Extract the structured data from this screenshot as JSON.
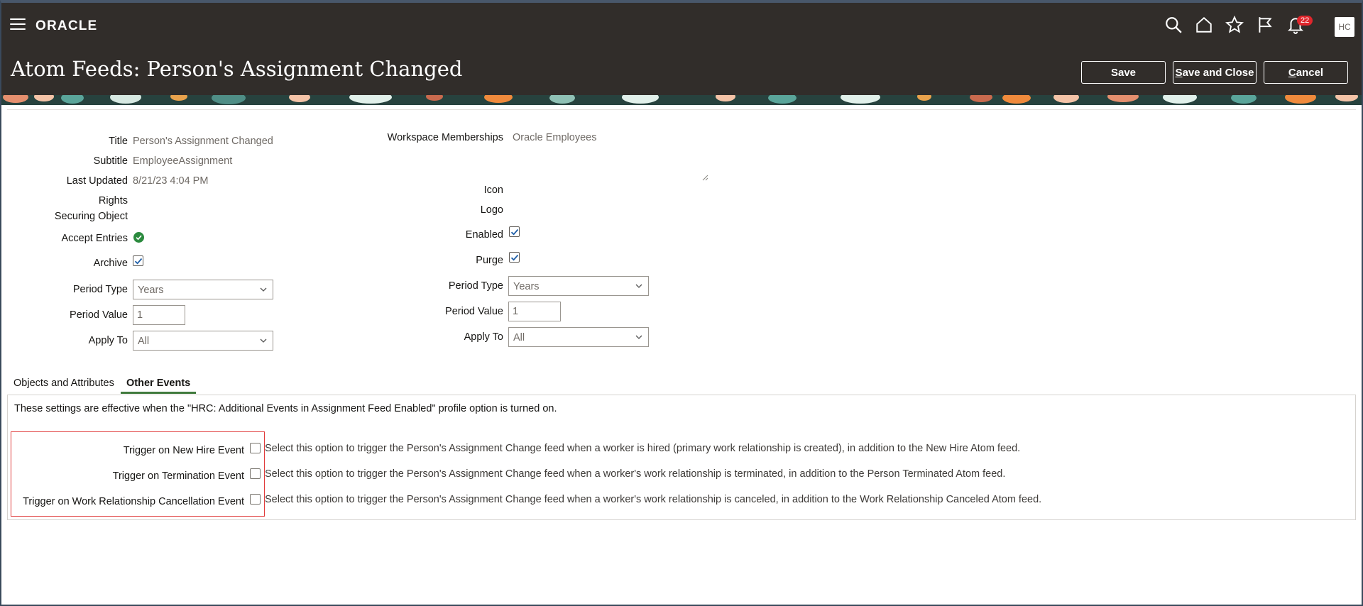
{
  "header": {
    "brand": "ORACLE",
    "title": "Atom Feeds: Person's Assignment Changed",
    "notification_count": "22",
    "avatar_initials": "HC",
    "buttons": {
      "save": "Save",
      "save_and_close_rest": "ave and Close",
      "save_and_close_mnemonic": "S",
      "cancel_mnemonic": "C",
      "cancel_rest": "ancel"
    },
    "icons": [
      "search-icon",
      "home-icon",
      "star-icon",
      "flag-icon",
      "bell-icon"
    ]
  },
  "form": {
    "left": {
      "title_label": "Title",
      "title_value": "Person's Assignment Changed",
      "subtitle_label": "Subtitle",
      "subtitle_value": "EmployeeAssignment",
      "last_updated_label": "Last Updated",
      "last_updated_value": "8/21/23 4:04 PM",
      "rights_label": "Rights",
      "securing_object_label": "Securing Object",
      "accept_entries_label": "Accept Entries",
      "archive_label": "Archive",
      "archive_checked": true,
      "period_type_label": "Period Type",
      "period_type_value": "Years",
      "period_value_label": "Period Value",
      "period_value_value": "1",
      "apply_to_label": "Apply To",
      "apply_to_value": "All"
    },
    "right": {
      "workspace_label": "Workspace Memberships",
      "workspace_value": "Oracle Employees",
      "icon_label": "Icon",
      "logo_label": "Logo",
      "enabled_label": "Enabled",
      "enabled_checked": true,
      "purge_label": "Purge",
      "purge_checked": true,
      "period_type_label": "Period Type",
      "period_type_value": "Years",
      "period_value_label": "Period Value",
      "period_value_value": "1",
      "apply_to_label": "Apply To",
      "apply_to_value": "All"
    }
  },
  "tabs": [
    {
      "label": "Objects and Attributes",
      "active": false
    },
    {
      "label": "Other Events",
      "active": true
    }
  ],
  "other_events": {
    "info": "These settings are effective when the \"HRC: Additional Events in Assignment Feed Enabled\" profile option is turned on.",
    "rows": [
      {
        "label": "Trigger on New Hire Event",
        "description": "Select this option to trigger the Person's Assignment Change feed when a worker is hired (primary work relationship is created), in addition to the New Hire Atom feed."
      },
      {
        "label": "Trigger on Termination Event",
        "description": "Select this option to trigger the Person's Assignment Change feed when a worker's work relationship is terminated, in addition to the Person Terminated Atom feed."
      },
      {
        "label": "Trigger on Work Relationship Cancellation Event",
        "description": "Select this option to trigger the Person's Assignment Change feed when a worker's work relationship is canceled, in addition to the Work Relationship Canceled Atom feed."
      }
    ]
  },
  "colors": {
    "header_bg": "#312d2a",
    "accent_green": "#3f7a3c",
    "highlight_red": "#e03a3a",
    "badge_red": "#e0262c"
  }
}
